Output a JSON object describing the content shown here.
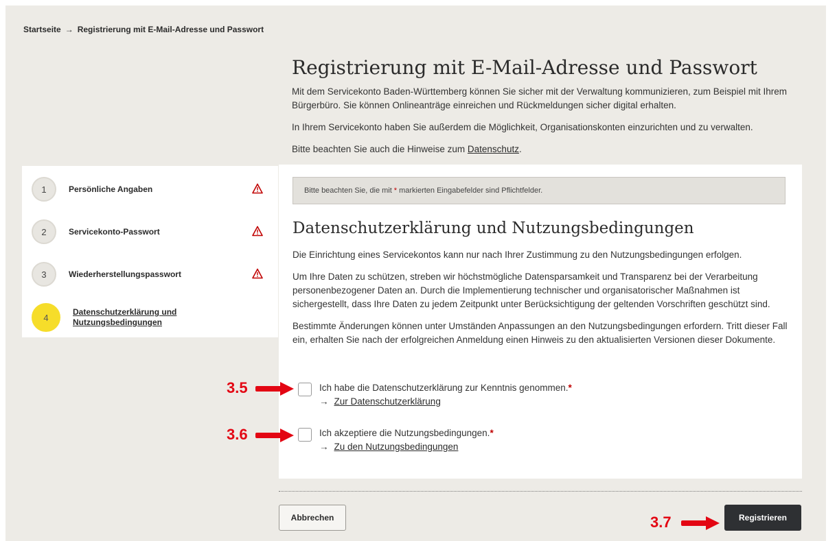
{
  "breadcrumb": {
    "home": "Startseite",
    "separator": "→",
    "current": "Registrierung mit E-Mail-Adresse und Passwort"
  },
  "page": {
    "title": "Registrierung mit E-Mail-Adresse und Passwort",
    "intro_1": "Mit dem Servicekonto Baden-Württemberg können Sie sicher mit der Verwaltung kommunizieren, zum Beispiel mit Ihrem Bürgerbüro. Sie können Onlineanträge einreichen und Rückmeldungen sicher digital erhalten.",
    "intro_2": "In Ihrem Servicekonto haben Sie außerdem die Möglichkeit, Organisationskonten einzurichten und zu verwalten.",
    "intro_3_prefix": "Bitte beachten Sie auch die Hinweise zum ",
    "intro_3_link": "Datenschutz",
    "intro_3_suffix": "."
  },
  "steps": [
    {
      "number": "1",
      "label": "Persönliche Angaben",
      "warning": true
    },
    {
      "number": "2",
      "label": "Servicekonto-Passwort",
      "warning": true
    },
    {
      "number": "3",
      "label": "Wiederherstellungspasswort",
      "warning": true
    },
    {
      "number": "4",
      "label_line1": "Datenschutzerklärung und",
      "label_line2": "Nutzungsbedingungen",
      "current": true
    }
  ],
  "notice": {
    "prefix": "Bitte beachten Sie, die mit",
    "asterisk": "*",
    "suffix": "markierten Eingabefelder sind Pflichtfelder."
  },
  "section": {
    "title": "Datenschutzerklärung und Nutzungsbedingungen",
    "p1": "Die Einrichtung eines Servicekontos kann nur nach Ihrer Zustimmung zu den Nutzungsbedingungen erfolgen.",
    "p2": "Um Ihre Daten zu schützen, streben wir höchstmögliche Datensparsamkeit und Transparenz bei der Verarbeitung personenbezogener Daten an. Durch die Implementierung technischer und organisatorischer Maßnahmen ist sichergestellt, dass Ihre Daten zu jedem Zeitpunkt unter Berücksichtigung der geltenden Vorschriften geschützt sind.",
    "p3": "Bestimmte Änderungen können unter Umständen Anpassungen an den Nutzungsbedingungen erfordern. Tritt dieser Fall ein, erhalten Sie nach der erfolgreichen Anmeldung einen Hinweis zu den aktualisierten Versionen dieser Dokumente."
  },
  "checkboxes": {
    "privacy_label": "Ich habe die Datenschutzerklärung zur Kenntnis genommen.",
    "privacy_link": "Zur Datenschutzerklärung",
    "terms_label": "Ich akzeptiere die Nutzungsbedingungen.",
    "terms_link": "Zu den Nutzungsbedingungen",
    "required_marker": "*",
    "arrow": "→"
  },
  "buttons": {
    "cancel": "Abbrechen",
    "register": "Registrieren"
  },
  "annotations": {
    "a1": "3.5",
    "a2": "3.6",
    "a3": "3.7"
  },
  "colors": {
    "accent_yellow": "#f6dd2a",
    "required_red": "#c00000",
    "annotation_red": "#e30613",
    "register_bg": "#2e3033"
  }
}
